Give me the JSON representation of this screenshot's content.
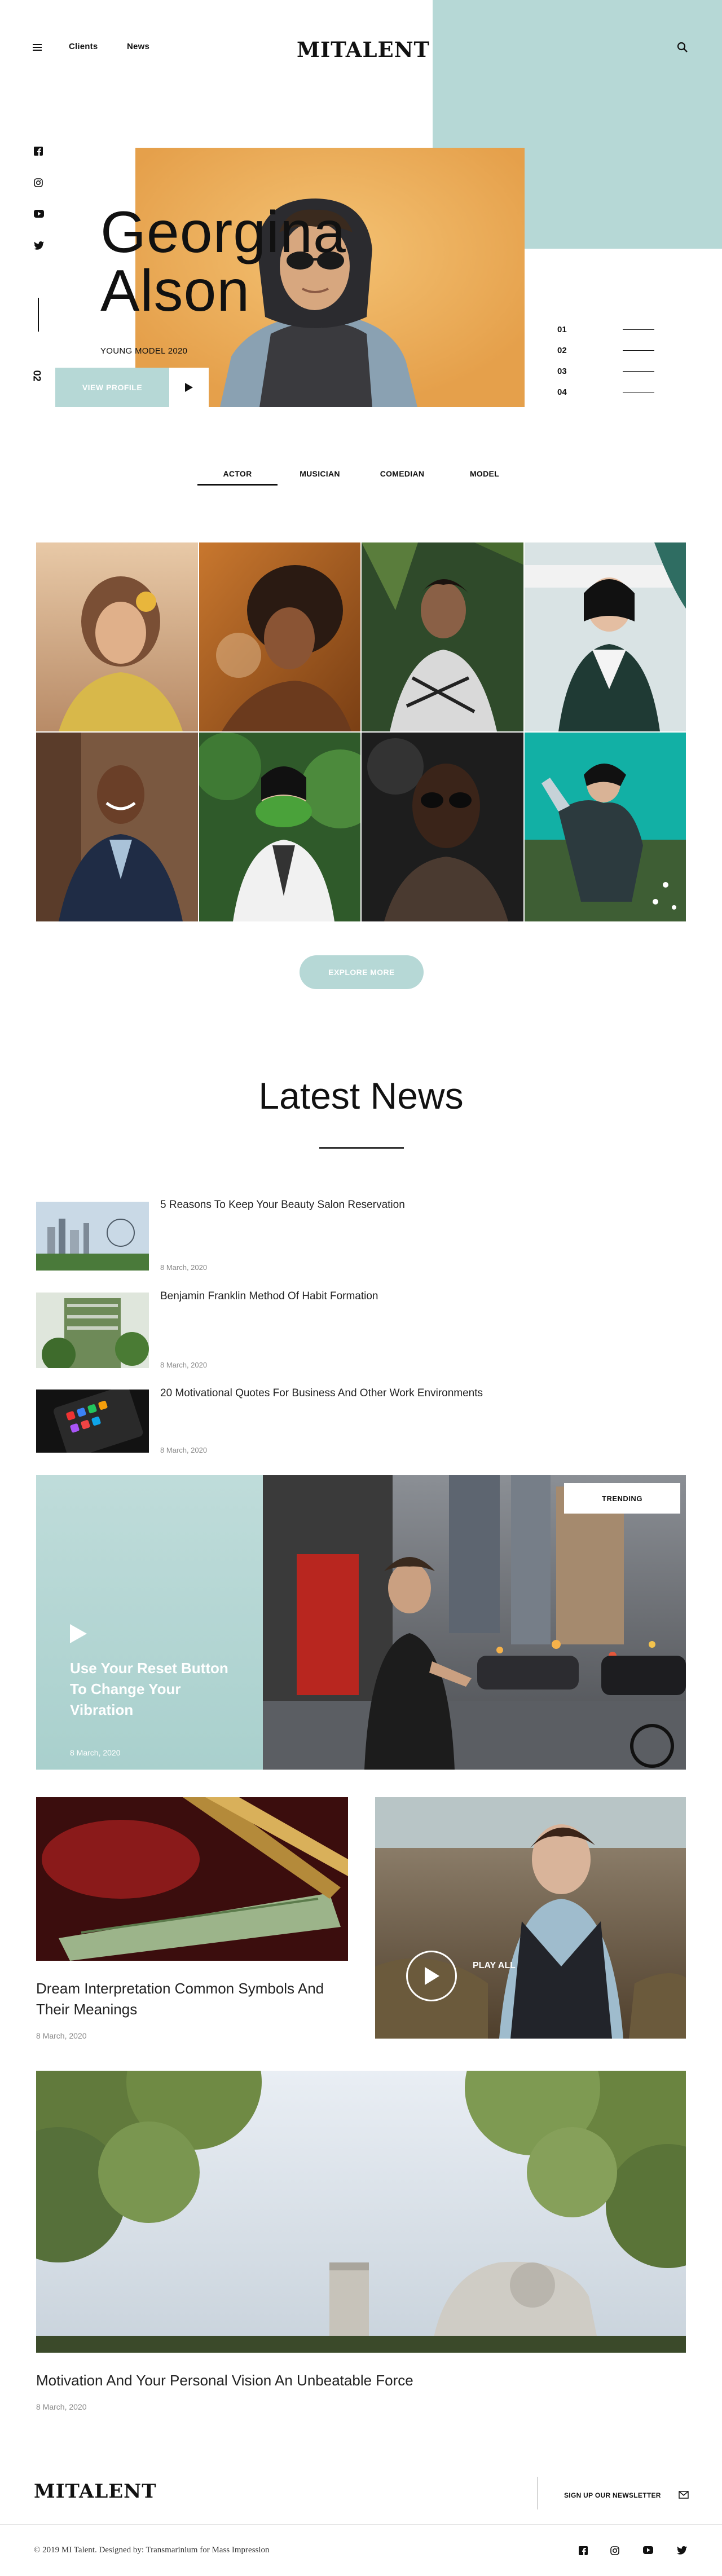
{
  "header": {
    "nav": [
      "Clients",
      "News"
    ],
    "logo": "MITALENT"
  },
  "social": [
    "facebook-icon",
    "instagram-icon",
    "youtube-icon",
    "twitter-icon"
  ],
  "hero": {
    "slide_number": "02",
    "name_line1": "Georgina",
    "name_line2": "Alson",
    "tagline": "YOUNG MODEL 2020",
    "view_button": "VIEW PROFILE",
    "pager": [
      "01",
      "02",
      "03",
      "04"
    ]
  },
  "tabs": [
    "ACTOR",
    "MUSICIAN",
    "COMEDIAN",
    "MODEL"
  ],
  "explore_button": "EXPLORE MORE",
  "news": {
    "title": "Latest News",
    "list": [
      {
        "title": "5 Reasons To Keep Your Beauty Salon Reservation",
        "date": "8 March, 2020"
      },
      {
        "title": "Benjamin Franklin Method Of Habit Formation",
        "date": "8 March, 2020"
      },
      {
        "title": "20 Motivational Quotes For Business And Other Work Environments",
        "date": "8 March, 2020"
      }
    ],
    "trending": {
      "badge": "TRENDING",
      "title": "Use Your Reset Button To Change Your Vibration",
      "date": "8 March, 2020"
    },
    "card1": {
      "title": "Dream Interpretation Common Symbols And Their Meanings",
      "date": "8 March, 2020"
    },
    "card2": {
      "play_label": "PLAY ALL"
    },
    "card3": {
      "title": "Motivation And Your Personal Vision An Unbeatable Force",
      "date": "8 March, 2020"
    }
  },
  "footer": {
    "logo": "MITALENT",
    "newsletter": "SIGN UP OUR NEWSLETTER",
    "copyright": "© 2019 MI Talent. Designed by: Transmarinium for Mass Impression",
    "icons": [
      "facebook-icon",
      "instagram-icon",
      "youtube-icon",
      "twitter-icon"
    ]
  },
  "colors": {
    "accent": "#b6d8d6",
    "hero_bg": "#eaaa52",
    "text": "#111111"
  }
}
